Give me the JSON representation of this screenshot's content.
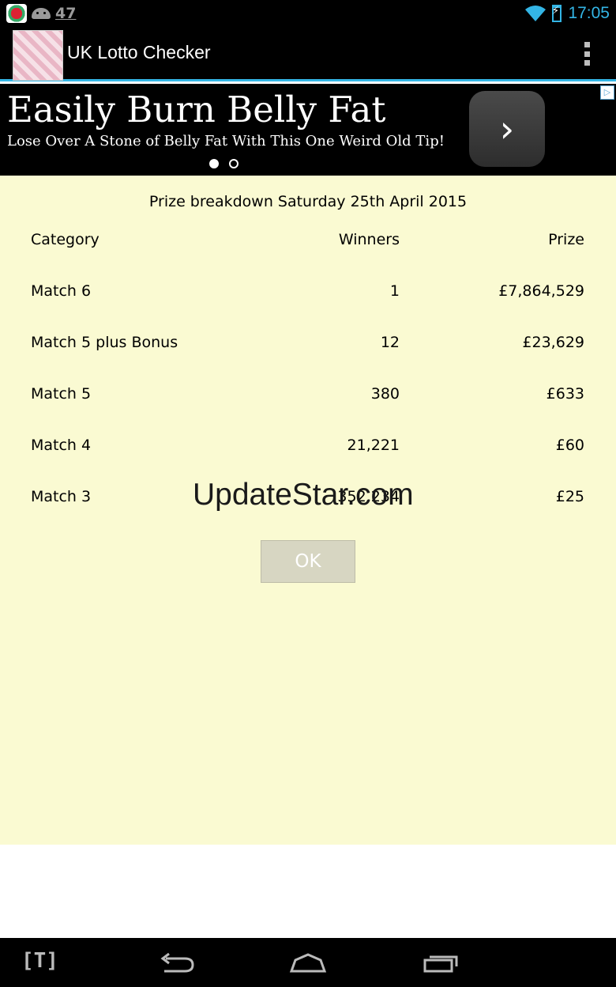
{
  "status_bar": {
    "notification_count": "47",
    "time": "17:05",
    "icons": [
      "app-notification-icon",
      "android-icon",
      "wifi-icon",
      "battery-charging-icon"
    ]
  },
  "action_bar": {
    "title": "UK Lotto Checker",
    "overflow_icon": "overflow-menu-icon"
  },
  "ad": {
    "headline": "Easily Burn Belly Fat",
    "subline": "Lose Over A Stone of Belly Fat With This One Weird Old Tip!",
    "arrow_glyph": "›",
    "ad_choices_glyph": "▷",
    "pages": 2,
    "active_page": 0
  },
  "prize": {
    "title": "Prize breakdown Saturday 25th April 2015",
    "headers": {
      "category": "Category",
      "winners": "Winners",
      "prize": "Prize"
    },
    "rows": [
      {
        "category": "Match 6",
        "winners": "1",
        "prize": "£7,864,529"
      },
      {
        "category": "Match 5 plus Bonus",
        "winners": "12",
        "prize": "£23,629"
      },
      {
        "category": "Match 5",
        "winners": "380",
        "prize": "£633"
      },
      {
        "category": "Match 4",
        "winners": "21,221",
        "prize": "£60"
      },
      {
        "category": "Match 3",
        "winners": "352,234",
        "prize": "£25"
      }
    ],
    "ok_label": "OK"
  },
  "watermark": "UpdateStar.com",
  "nav_bar": {
    "t_label": "[T]",
    "icons": [
      "back-icon",
      "home-icon",
      "recent-apps-icon"
    ]
  },
  "colors": {
    "accent": "#33b5e5",
    "content_bg": "#fafad2",
    "ok_button_bg": "#d7d6c2"
  }
}
